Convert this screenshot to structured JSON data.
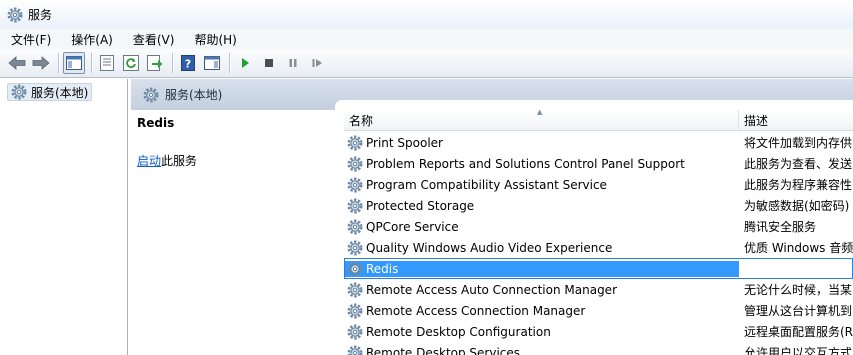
{
  "window": {
    "title": "服务",
    "icon": "gear-icon"
  },
  "menu": [
    {
      "label": "文件(F)"
    },
    {
      "label": "操作(A)"
    },
    {
      "label": "查看(V)"
    },
    {
      "label": "帮助(H)"
    }
  ],
  "toolbar": {
    "icons": [
      "back-arrow-icon",
      "forward-arrow-icon",
      "show-hide-tree-icon",
      "properties-icon",
      "refresh-icon",
      "export-list-icon",
      "help-icon",
      "action-pane-icon",
      "start-icon",
      "stop-icon",
      "pause-icon",
      "restart-icon"
    ]
  },
  "tree": {
    "item_label": "服务(本地)"
  },
  "pane": {
    "header_title": "服务(本地)",
    "selected_service": "Redis",
    "start_link": "启动",
    "start_suffix": "此服务"
  },
  "columns": {
    "name": "名称",
    "description": "描述"
  },
  "rows": [
    {
      "name": "Print Spooler",
      "desc": "将文件加载到内存供"
    },
    {
      "name": "Problem Reports and Solutions Control Panel Support",
      "desc": "此服务为查看、发送"
    },
    {
      "name": "Program Compatibility Assistant Service",
      "desc": "此服务为程序兼容性"
    },
    {
      "name": "Protected Storage",
      "desc": "为敏感数据(如密码)"
    },
    {
      "name": "QPCore Service",
      "desc": "腾讯安全服务"
    },
    {
      "name": "Quality Windows Audio Video Experience",
      "desc": "优质 Windows 音频"
    },
    {
      "name": "Redis",
      "desc": ""
    },
    {
      "name": "Remote Access Auto Connection Manager",
      "desc": "无论什么时候，当某"
    },
    {
      "name": "Remote Access Connection Manager",
      "desc": "管理从这台计算机到"
    },
    {
      "name": "Remote Desktop Configuration",
      "desc": "远程桌面配置服务(R"
    },
    {
      "name": "Remote Desktop Services",
      "desc": "允许用户以交互方式"
    }
  ],
  "selected_row_index": 6,
  "colors": {
    "selection": "#3399ff",
    "link": "#0b5cd6",
    "header_band": "#c4d0de"
  }
}
